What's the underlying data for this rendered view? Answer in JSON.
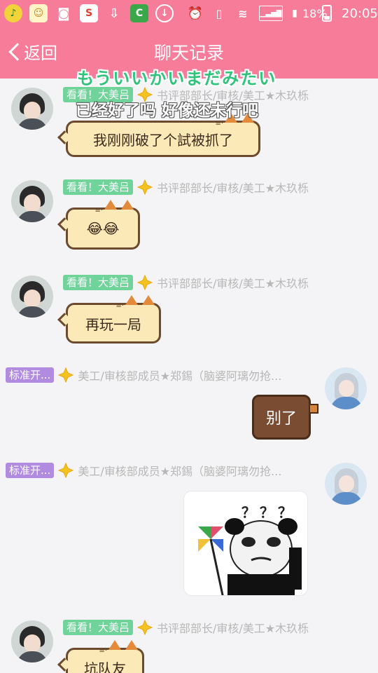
{
  "status_bar": {
    "battery_percent": "18%",
    "time": "20:05",
    "colors": {
      "bar": "#f77c9a"
    }
  },
  "header": {
    "back_label": "返回",
    "title": "聊天记录"
  },
  "overlay": {
    "japanese": "もういいかいまだみたい",
    "chinese": "已经好了吗 好像还未行吧"
  },
  "messages": [
    {
      "side": "left",
      "badge": "看看！大美吕",
      "info": "书评部部长/审核/美工★木玖栎",
      "text": "我刚刚破了个試被抓了"
    },
    {
      "side": "left",
      "badge": "看看！大美吕",
      "info": "书评部部长/审核/美工★木玖栎",
      "text": "😂😂"
    },
    {
      "side": "left",
      "badge": "看看！大美吕",
      "info": "书评部部长/审核/美工★木玖栎",
      "text": "再玩一局"
    },
    {
      "side": "right",
      "badge": "标准开...",
      "info": "美工/审核部成员★郑錫（脑婆阿璃勿抢...",
      "text": "别了"
    },
    {
      "side": "right",
      "badge": "标准开...",
      "info": "美工/审核部成员★郑錫（脑婆阿璃勿抢...",
      "image_caption": "？？？"
    },
    {
      "side": "left",
      "badge": "看看！大美吕",
      "info": "书评部部长/审核/美工★木玖栎",
      "text": "坑队友"
    }
  ],
  "colors": {
    "accent": "#f77c9a",
    "badge_green": "#6fd39a",
    "badge_purple": "#b08be0",
    "bubble_fill": "#fbe9b8",
    "bubble_border": "#6b4a2e",
    "bubble_right": "#7a4d32"
  }
}
